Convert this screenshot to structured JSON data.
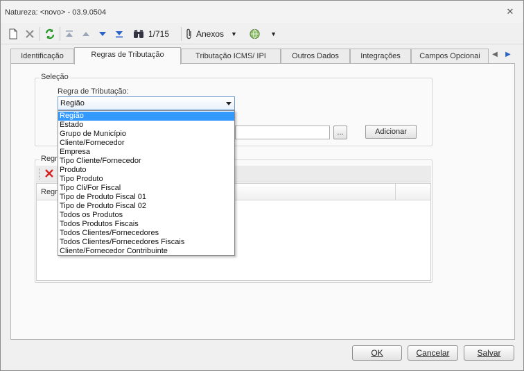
{
  "window": {
    "title": "Natureza: <novo> - 03.9.0504"
  },
  "toolbar": {
    "record_counter": "1/715",
    "anexos_label": "Anexos"
  },
  "tabs": [
    {
      "label": "Identificação"
    },
    {
      "label": "Regras de Tributação"
    },
    {
      "label": "Tributação ICMS/ IPI"
    },
    {
      "label": "Outros Dados"
    },
    {
      "label": "Integrações"
    },
    {
      "label": "Campos Opcionai"
    }
  ],
  "selecao": {
    "group_label": "Seleção",
    "field_label": "Regra de Tributação:",
    "selected_value": "Região",
    "browse_button": "...",
    "add_button": "Adicionar"
  },
  "regras": {
    "group_label": "Regra",
    "column_header": "Regr"
  },
  "dropdown": {
    "options": [
      "Região",
      "Estado",
      "Grupo de Município",
      "Cliente/Fornecedor",
      "Empresa",
      "Tipo Cliente/Fornecedor",
      "Produto",
      "Tipo Produto",
      "Tipo Cli/For Fiscal",
      "Tipo de Produto Fiscal 01",
      "Tipo de Produto Fiscal 02",
      "Todos os Produtos",
      "Todos Produtos Fiscais",
      "Todos Clientes/Fornecedores",
      "Todos Clientes/Fornecedores Fiscais",
      "Cliente/Fornecedor Contribuinte"
    ],
    "selected_index": 0
  },
  "footer": {
    "ok": "OK",
    "cancel": "Cancelar",
    "save": "Salvar"
  },
  "colors": {
    "selection": "#3399ff",
    "refresh_green": "#2e9a2e",
    "nav_blue": "#2a63c8",
    "delete_red": "#d42020"
  }
}
